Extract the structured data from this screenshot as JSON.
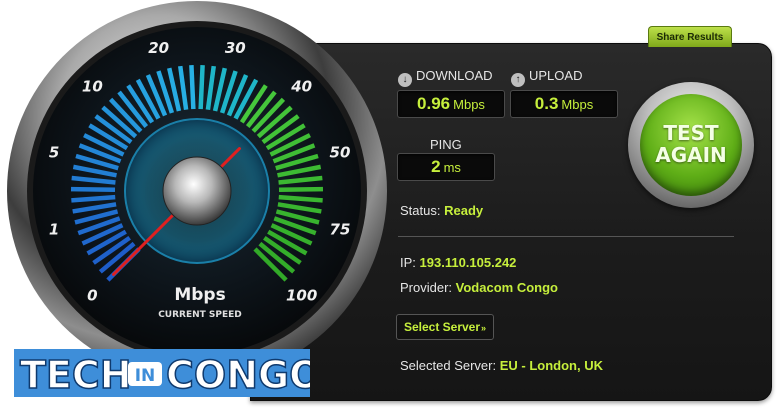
{
  "share_label": "Share Results",
  "download": {
    "label": "DOWNLOAD",
    "value": "0.96",
    "unit": "Mbps",
    "icon": "arrow-down-icon"
  },
  "upload": {
    "label": "UPLOAD",
    "value": "0.3",
    "unit": "Mbps",
    "icon": "arrow-up-icon"
  },
  "ping": {
    "label": "PING",
    "value": "2",
    "unit": "ms"
  },
  "status": {
    "label": "Status:",
    "value": "Ready"
  },
  "ip": {
    "label": "IP:",
    "value": "193.110.105.242"
  },
  "provider": {
    "label": "Provider:",
    "value": "Vodacom Congo"
  },
  "select_server_label": "Select Server",
  "selected_server": {
    "label": "Selected Server:",
    "value": "EU - London, UK"
  },
  "test_button": {
    "line1": "TEST",
    "line2": "AGAIN"
  },
  "gauge": {
    "ticks": [
      "0",
      "1",
      "5",
      "10",
      "20",
      "30",
      "40",
      "50",
      "75",
      "100"
    ],
    "unit_label": "Mbps",
    "caption": "CURRENT SPEED",
    "needle_value": 0.96
  },
  "logo": {
    "left": "TECH",
    "middle": "IN",
    "right": "CONGO"
  },
  "colors": {
    "accent": "#c6ef3c",
    "panel": "#1e1e1e",
    "logo_blue": "#3e8ed9"
  }
}
